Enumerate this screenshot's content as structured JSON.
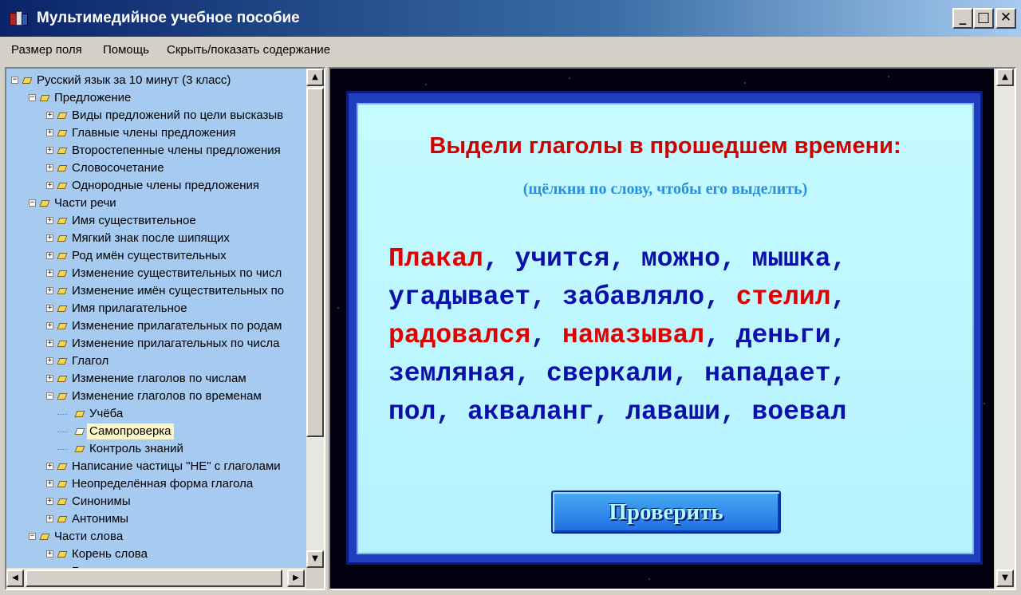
{
  "window": {
    "title": "Мультимедийное учебное пособие",
    "controls": {
      "minimize": "_",
      "maximize": "□",
      "close": "✕"
    }
  },
  "menu": [
    {
      "label": "Размер поля"
    },
    {
      "label": "Помощь"
    },
    {
      "label": "Скрыть/показать содержание"
    }
  ],
  "tree": {
    "root": "Русский язык за 10 минут (3 класс)",
    "items": [
      "Предложение",
      "Виды предложений по цели высказыв",
      "Главные члены предложения",
      "Второстепенные члены предложения",
      "Словосочетание",
      "Однородные члены предложения",
      "Части речи",
      "Имя существительное",
      "Мягкий знак после шипящих",
      "Род имён существительных",
      "Изменение существительных по числ",
      "Изменение имён существительных по",
      "Имя прилагательное",
      "Изменение прилагательных по родам",
      "Изменение прилагательных по числа",
      "Глагол",
      "Изменение глаголов по числам",
      "Изменение глаголов по временам",
      "Учёба",
      "Самопроверка",
      "Контроль знаний",
      "Написание частицы \"НЕ\" с глаголами",
      "Неопределённая форма глагола",
      "Синонимы",
      "Антонимы",
      "Части слова",
      "Корень слова",
      "Безударные гласные в корне"
    ],
    "selected": "Самопроверка"
  },
  "exercise": {
    "title": "Выдели глаголы в прошедшем времени:",
    "hint": "(щёлкни по слову, чтобы его выделить)",
    "lines": [
      [
        {
          "w": "Плакал",
          "selected": true
        },
        {
          "w": "учится"
        },
        {
          "w": "можно"
        },
        {
          "w": "мышка"
        }
      ],
      [
        {
          "w": "угадывает"
        },
        {
          "w": "забавляло"
        },
        {
          "w": "стелил",
          "selected": true
        }
      ],
      [
        {
          "w": "радовался",
          "selected": true
        },
        {
          "w": "намазывал",
          "selected": true
        },
        {
          "w": "деньги"
        }
      ],
      [
        {
          "w": "земляная"
        },
        {
          "w": "сверкали"
        },
        {
          "w": "нападает"
        }
      ],
      [
        {
          "w": "пол"
        },
        {
          "w": "акваланг"
        },
        {
          "w": "лаваши"
        },
        {
          "w": "воевал"
        }
      ]
    ],
    "button_label": "Проверить"
  },
  "colors": {
    "highlight_word": "#e00000",
    "normal_word": "#0a10a8",
    "title": "#d10000",
    "hint": "#2a8fe0"
  }
}
